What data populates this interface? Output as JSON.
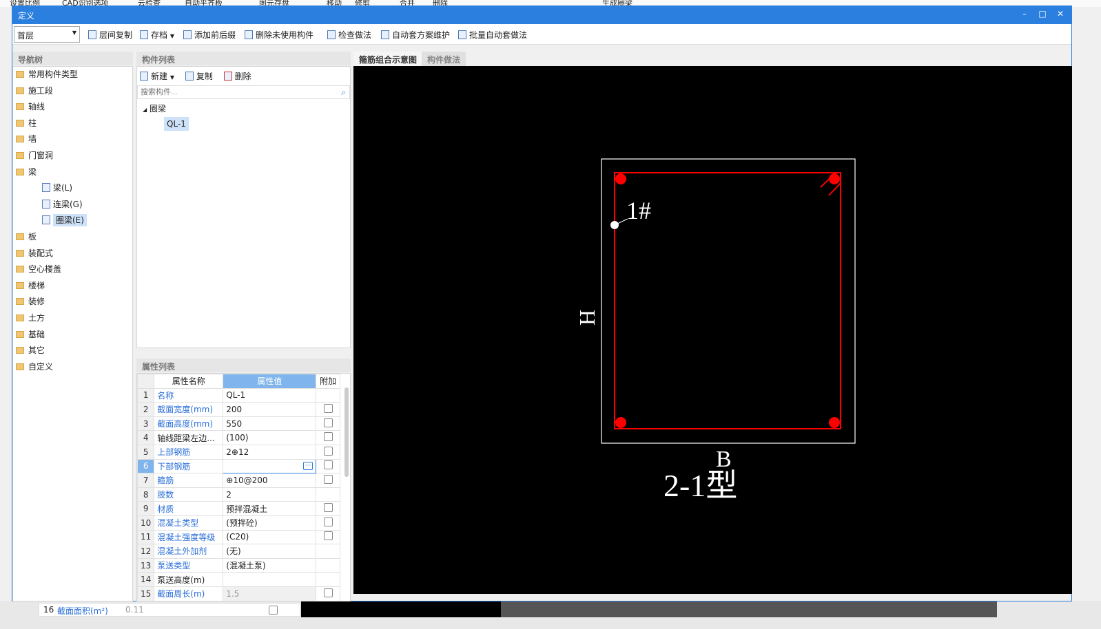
{
  "background": {
    "toolbar": [
      "设置比例",
      "CAD识别选项",
      "云检查",
      "自动平齐板",
      "图元存盘",
      "移动",
      "修剪",
      "合并",
      "删除",
      "生成圈梁"
    ],
    "row16": {
      "num": "16",
      "name": "截面面积(m²)",
      "value": "0.11"
    }
  },
  "window": {
    "title": "定义",
    "minimize": "–",
    "maximize": "□",
    "close": "✕"
  },
  "toolbar": {
    "floor": "首层",
    "items": [
      {
        "label": "层间复制",
        "icon": "copy-icon"
      },
      {
        "label": "存档",
        "icon": "archive-icon",
        "dropdown": true
      },
      {
        "label": "添加前后缀",
        "icon": "prefix-icon"
      },
      {
        "label": "删除未使用构件",
        "icon": "delete-unused-icon"
      },
      {
        "label": "检查做法",
        "icon": "check-icon"
      },
      {
        "label": "自动套方案维护",
        "icon": "scheme-icon"
      },
      {
        "label": "批量自动套做法",
        "icon": "batch-icon"
      }
    ]
  },
  "nav": {
    "title": "导航树",
    "items": [
      {
        "label": "常用构件类型"
      },
      {
        "label": "施工段"
      },
      {
        "label": "轴线"
      },
      {
        "label": "柱"
      },
      {
        "label": "墙"
      },
      {
        "label": "门窗洞"
      },
      {
        "label": "梁",
        "expanded": true
      },
      {
        "label": "梁(L)",
        "sub": true
      },
      {
        "label": "连梁(G)",
        "sub": true
      },
      {
        "label": "圈梁(E)",
        "sub": true,
        "selected": true
      },
      {
        "label": "板"
      },
      {
        "label": "装配式"
      },
      {
        "label": "空心楼盖"
      },
      {
        "label": "楼梯"
      },
      {
        "label": "装修"
      },
      {
        "label": "土方"
      },
      {
        "label": "基础"
      },
      {
        "label": "其它"
      },
      {
        "label": "自定义"
      }
    ]
  },
  "components": {
    "title": "构件列表",
    "new": "新建",
    "copy": "复制",
    "delete": "删除",
    "search_placeholder": "搜索构件...",
    "group": "圈梁",
    "item": "QL-1"
  },
  "properties": {
    "title": "属性列表",
    "headers": [
      "属性名称",
      "属性值",
      "附加"
    ],
    "rows": [
      {
        "n": "1",
        "name": "名称",
        "value": "QL-1",
        "blue": true,
        "cb": false
      },
      {
        "n": "2",
        "name": "截面宽度(mm)",
        "value": "200",
        "blue": true,
        "cb": true
      },
      {
        "n": "3",
        "name": "截面高度(mm)",
        "value": "550",
        "blue": true,
        "cb": true
      },
      {
        "n": "4",
        "name": "轴线距梁左边...",
        "value": "(100)",
        "blue": false,
        "cb": true
      },
      {
        "n": "5",
        "name": "上部钢筋",
        "value": "2⊕12",
        "blue": true,
        "cb": true
      },
      {
        "n": "6",
        "name": "下部钢筋",
        "value": "",
        "blue": true,
        "cb": true,
        "editing": true
      },
      {
        "n": "7",
        "name": "箍筋",
        "value": "⊕10@200",
        "blue": true,
        "cb": true
      },
      {
        "n": "8",
        "name": "肢数",
        "value": "2",
        "blue": true,
        "cb": false
      },
      {
        "n": "9",
        "name": "材质",
        "value": "预拌混凝土",
        "blue": true,
        "cb": true
      },
      {
        "n": "10",
        "name": "混凝土类型",
        "value": "(预拌砼)",
        "blue": true,
        "cb": true
      },
      {
        "n": "11",
        "name": "混凝土强度等级",
        "value": "(C20)",
        "blue": true,
        "cb": true
      },
      {
        "n": "12",
        "name": "混凝土外加剂",
        "value": "(无)",
        "blue": true,
        "cb": false
      },
      {
        "n": "13",
        "name": "泵送类型",
        "value": "(混凝土泵)",
        "blue": true,
        "cb": false
      },
      {
        "n": "14",
        "name": "泵送高度(m)",
        "value": "",
        "blue": false,
        "cb": false
      },
      {
        "n": "15",
        "name": "截面周长(m)",
        "value": "1.5",
        "blue": true,
        "cb": true,
        "grey": true
      }
    ]
  },
  "tabs": [
    {
      "label": "箍筋组合示意图",
      "active": true
    },
    {
      "label": "构件做法",
      "active": false
    }
  ],
  "drawing": {
    "rebar_label": "1#",
    "height_label": "H",
    "width_label": "B",
    "type_label": "2-1型",
    "stirrup_color": "#ff0000",
    "outline_color": "#ffffff"
  }
}
